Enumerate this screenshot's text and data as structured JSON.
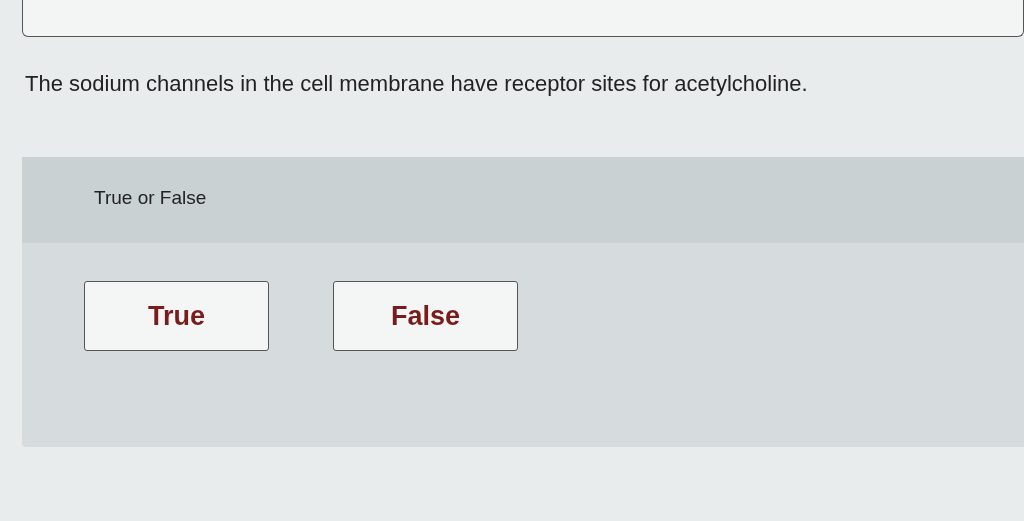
{
  "question": {
    "text": "The sodium channels in the cell membrane have receptor sites for acetylcholine."
  },
  "answer_panel": {
    "prompt": "True or False",
    "options": [
      {
        "label": "True",
        "selected": false
      },
      {
        "label": "False",
        "selected": false
      }
    ]
  }
}
